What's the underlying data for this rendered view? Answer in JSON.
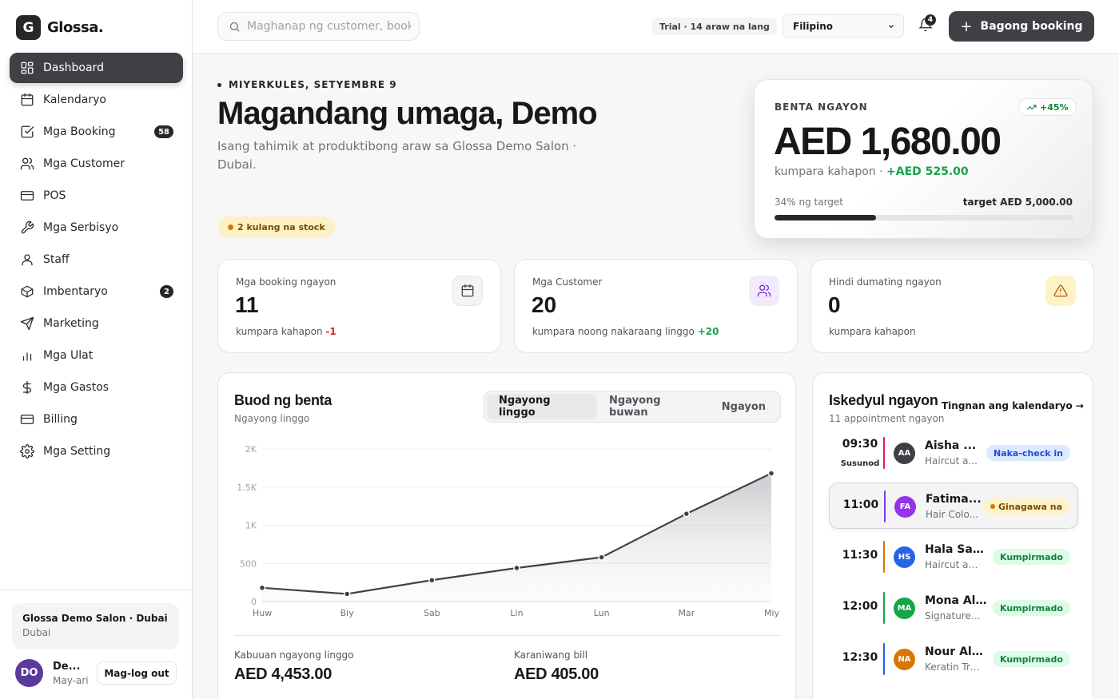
{
  "brand": {
    "mark": "G",
    "name": "Glossa."
  },
  "sidebar": {
    "items": [
      {
        "label": "Dashboard",
        "icon": "dashboard-icon",
        "active": true
      },
      {
        "label": "Kalendaryo",
        "icon": "calendar-icon"
      },
      {
        "label": "Mga Booking",
        "icon": "booking-check-icon",
        "badge": "58"
      },
      {
        "label": "Mga Customer",
        "icon": "users-icon"
      },
      {
        "label": "POS",
        "icon": "credit-card-icon"
      },
      {
        "label": "Mga Serbisyo",
        "icon": "wrench-icon"
      },
      {
        "label": "Staff",
        "icon": "user-icon"
      },
      {
        "label": "Imbentaryo",
        "icon": "box-icon",
        "badge": "2"
      },
      {
        "label": "Marketing",
        "icon": "send-icon"
      },
      {
        "label": "Mga Ulat",
        "icon": "bar-chart-icon"
      },
      {
        "label": "Mga Gastos",
        "icon": "dollar-icon"
      },
      {
        "label": "Billing",
        "icon": "billing-card-icon"
      },
      {
        "label": "Mga Setting",
        "icon": "gear-icon"
      }
    ],
    "salon": {
      "name": "Glossa Demo Salon · Dubai",
      "city": "Dubai"
    },
    "user": {
      "initials": "DO",
      "name": "De...",
      "role": "May-ari",
      "logout": "Mag-log out"
    }
  },
  "topbar": {
    "search_placeholder": "Maghanap ng customer, booking...",
    "trial": "Trial · 14 araw na lang",
    "language": "Filipino",
    "notifications": "4",
    "new_booking": "Bagong booking"
  },
  "greeting": {
    "date": "MIYERKULES, SETYEMBRE 9",
    "title": "Magandang umaga, Demo",
    "subtitle": "Isang tahimik at produktibong araw sa Glossa Demo Salon · Dubai.",
    "stock_alert": "2 kulang na stock"
  },
  "sales_today": {
    "label": "BENTA NGAYON",
    "trend": "+45%",
    "value": "AED 1,680.00",
    "compare_text": "kumpara kahapon ·",
    "compare_value": "+AED 525.00",
    "target_pct_text": "34% ng target",
    "target_text": "target AED 5,000.00",
    "target_fraction": 0.34
  },
  "stats": [
    {
      "label": "Mga booking ngayon",
      "value": "11",
      "compare": "kumpara kahapon",
      "delta": "-1",
      "delta_type": "neg",
      "icon": "calendar-icon"
    },
    {
      "label": "Mga Customer",
      "value": "20",
      "compare": "kumpara noong nakaraang linggo",
      "delta": "+20",
      "delta_type": "pos",
      "icon": "users-icon"
    },
    {
      "label": "Hindi dumating ngayon",
      "value": "0",
      "compare": "kumpara kahapon",
      "delta": "",
      "delta_type": "",
      "icon": "warning-icon"
    }
  ],
  "sales_chart": {
    "title": "Buod ng benta",
    "subtitle": "Ngayong linggo",
    "tabs": [
      "Ngayong linggo",
      "Ngayong buwan",
      "Ngayon"
    ],
    "active_tab": 0,
    "summary": [
      {
        "label": "Kabuuan ngayong linggo",
        "value": "AED 4,453.00"
      },
      {
        "label": "Karaniwang bill",
        "value": "AED 405.00"
      }
    ]
  },
  "chart_data": {
    "type": "area",
    "categories": [
      "Huw",
      "Biy",
      "Sab",
      "Lin",
      "Lun",
      "Mar",
      "Miy"
    ],
    "values": [
      180,
      100,
      280,
      440,
      580,
      1150,
      1680
    ],
    "y_ticks": [
      "0",
      "500",
      "1K",
      "1.5K",
      "2K"
    ],
    "y_tick_values": [
      0,
      500,
      1000,
      1500,
      2000
    ],
    "ylim": [
      0,
      2000
    ],
    "grid": true,
    "line_color": "#3f3f46"
  },
  "schedule": {
    "title": "Iskedyul ngayon",
    "subtitle": "11 appointment ngayon",
    "link": "Tingnan ang kalendaryo →",
    "items": [
      {
        "time": "09:30",
        "next": "Susunod",
        "initials": "AA",
        "name": "Aisha ...",
        "service": "Haircut a...",
        "status": "Naka-check in",
        "status_type": "checkin",
        "bar_color": "#e11d48",
        "avatar_color": "#3f3f46"
      },
      {
        "time": "11:00",
        "next": "",
        "initials": "FA",
        "name": "Fatima...",
        "service": "Hair Colo...",
        "status": "Ginagawa na",
        "status_type": "progress",
        "bar_color": "#7c3aed",
        "avatar_color": "#9333ea",
        "current": true
      },
      {
        "time": "11:30",
        "next": "",
        "initials": "HS",
        "name": "Hala Sal...",
        "service": "Haircut an...",
        "status": "Kumpirmado",
        "status_type": "confirmed",
        "bar_color": "#d97706",
        "avatar_color": "#2563eb"
      },
      {
        "time": "12:00",
        "next": "",
        "initials": "MA",
        "name": "Mona Al...",
        "service": "Signature F...",
        "status": "Kumpirmado",
        "status_type": "confirmed",
        "bar_color": "#16a34a",
        "avatar_color": "#16a34a"
      },
      {
        "time": "12:30",
        "next": "",
        "initials": "NA",
        "name": "Nour Al-...",
        "service": "Keratin Tre...",
        "status": "Kumpirmado",
        "status_type": "confirmed",
        "bar_color": "#2563eb",
        "avatar_color": "#d97706"
      }
    ]
  }
}
